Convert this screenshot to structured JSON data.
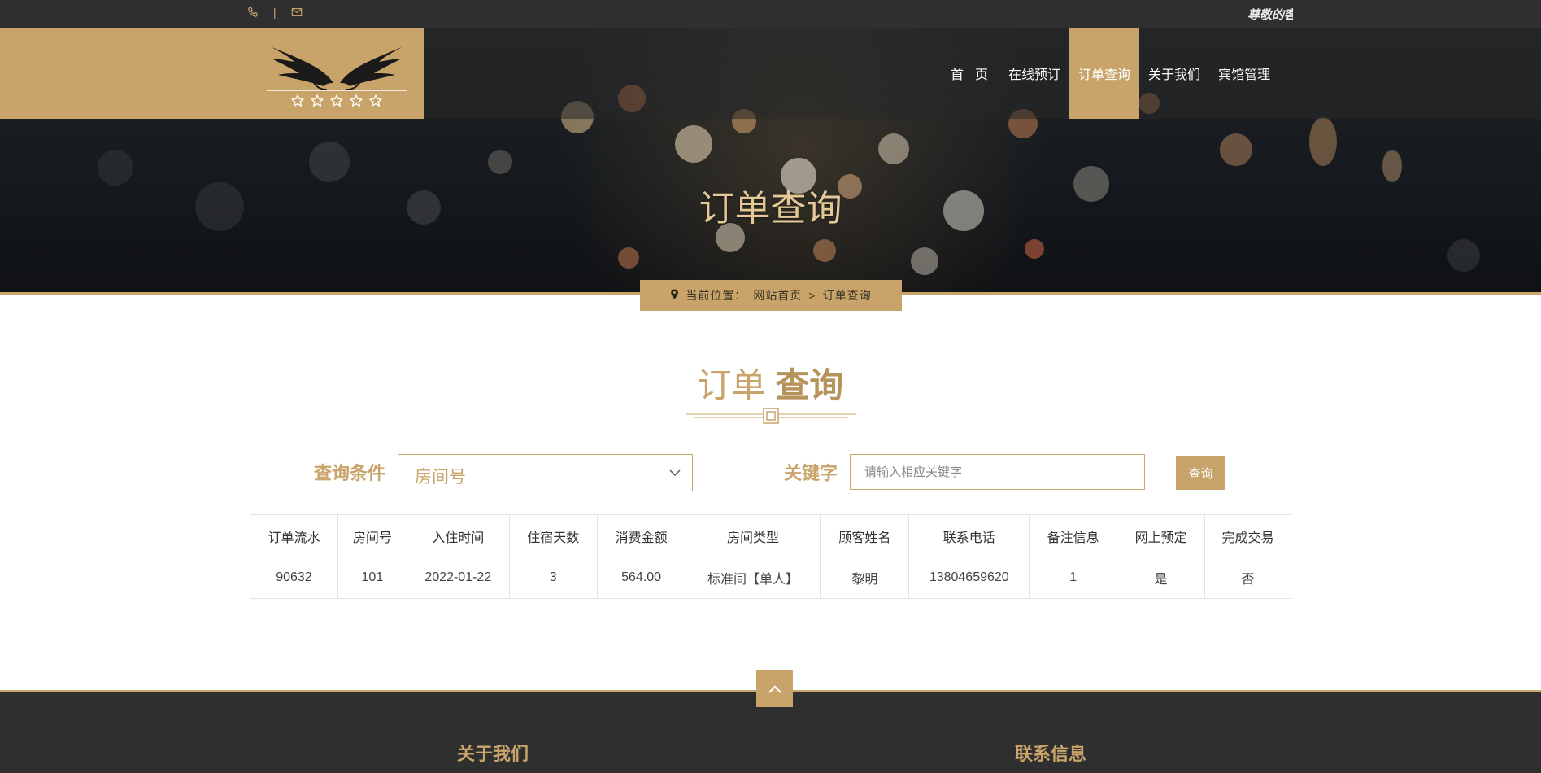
{
  "topbar": {
    "phone_icon": "phone-icon",
    "separator": "|",
    "mail_icon": "mail-icon",
    "welcome_text": "尊敬的客户"
  },
  "logo": {
    "name": "winged-five-star-logo"
  },
  "nav": {
    "items": [
      {
        "label": "首页"
      },
      {
        "label": "在线预订"
      },
      {
        "label": "订单查询",
        "active": true
      },
      {
        "label": "关于我们"
      },
      {
        "label": "宾馆管理"
      }
    ]
  },
  "hero": {
    "title": "订单查询"
  },
  "breadcrumb": {
    "icon": "map-pin-icon",
    "prefix": "当前位置：",
    "home": "网站首页",
    "arrow": ">",
    "current": "订单查询"
  },
  "section": {
    "title_light": "订单",
    "title_bold": "查询"
  },
  "search": {
    "condition_label": "查询条件",
    "condition_value": "房间号",
    "keyword_label": "关键字",
    "keyword_placeholder": "请输入相应关键字",
    "keyword_value": "",
    "button_label": "查询"
  },
  "table": {
    "headers": [
      "订单流水",
      "房间号",
      "入住时间",
      "住宿天数",
      "消费金额",
      "房间类型",
      "顾客姓名",
      "联系电话",
      "备注信息",
      "网上预定",
      "完成交易"
    ],
    "rows": [
      [
        "90632",
        "101",
        "2022-01-22",
        "3",
        "564.00",
        "标准间【单人】",
        "黎明",
        "13804659620",
        "1",
        "是",
        "否"
      ]
    ]
  },
  "footer": {
    "about_title": "关于我们",
    "contact_title": "联系信息",
    "back_to_top_icon": "chevron-up-icon"
  },
  "colors": {
    "gold": "#c8a46a",
    "dark": "#2f2f2f"
  }
}
